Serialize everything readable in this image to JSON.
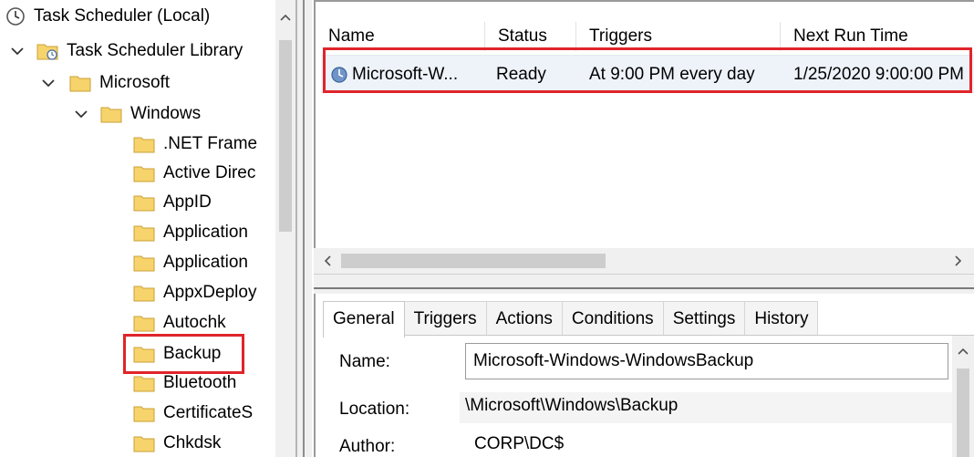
{
  "tree": {
    "root": "Task Scheduler (Local)",
    "library": "Task Scheduler Library",
    "microsoft": "Microsoft",
    "windows": "Windows",
    "folders": [
      ".NET Frame",
      "Active Direc",
      "AppID",
      "Application",
      "Application",
      "AppxDeploy",
      "Autochk",
      "Backup",
      "Bluetooth",
      "CertificateS",
      "Chkdsk"
    ],
    "selected_folder": "Backup"
  },
  "list": {
    "columns": [
      "Name",
      "Status",
      "Triggers",
      "Next Run Time"
    ],
    "rows": [
      {
        "name": "Microsoft-W...",
        "status": "Ready",
        "triggers": "At 9:00 PM every day",
        "next_run": "1/25/2020 9:00:00 PM"
      }
    ]
  },
  "details": {
    "tabs": [
      "General",
      "Triggers",
      "Actions",
      "Conditions",
      "Settings",
      "History"
    ],
    "active_tab": "General",
    "name_label": "Name:",
    "name_value": "Microsoft-Windows-WindowsBackup",
    "location_label": "Location:",
    "location_value": "\\Microsoft\\Windows\\Backup",
    "author_label": "Author:",
    "author_value": "CORP\\DC$"
  },
  "colors": {
    "highlight": "#e0242a",
    "folder": "#f6d36b",
    "row_bg": "#eef3fa"
  }
}
